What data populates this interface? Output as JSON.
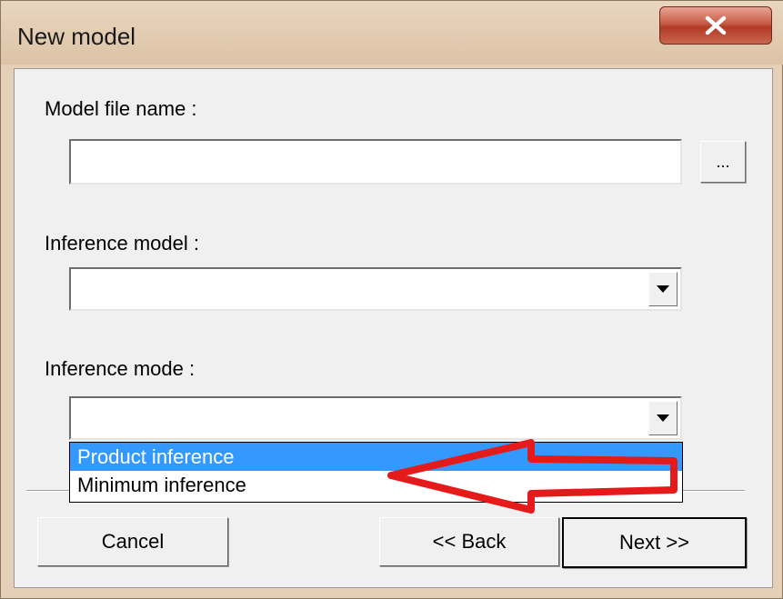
{
  "window": {
    "title": "New model",
    "close_glyph": "X"
  },
  "form": {
    "model_file_label": "Model file name :",
    "model_file_value": "",
    "browse_label": "...",
    "inference_model_label": "Inference model :",
    "inference_model_value": "",
    "inference_mode_label": "Inference mode :",
    "inference_mode_value": ""
  },
  "dropdown": {
    "options": [
      "Product inference",
      "Minimum inference"
    ],
    "highlighted": "Product inference"
  },
  "buttons": {
    "cancel": "Cancel",
    "back": "<< Back",
    "next": "Next >>"
  },
  "annotation": {
    "arrow_color": "#e51b1b"
  },
  "colors": {
    "selection": "#3399ff",
    "dialog_bg": "#f0f0f0"
  }
}
